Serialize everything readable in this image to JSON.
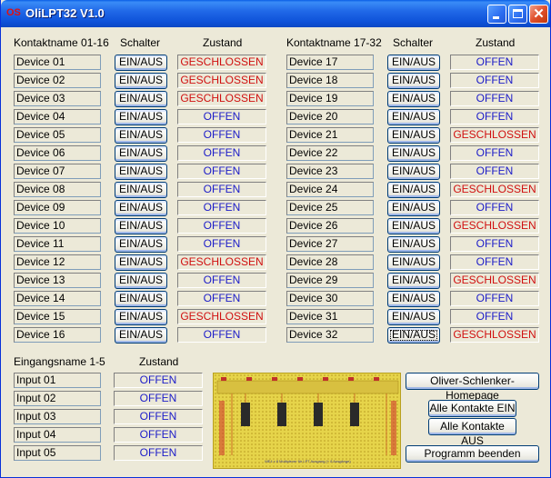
{
  "window": {
    "title": "OliLPT32 V1.0",
    "icon_text": "OS"
  },
  "left_group": {
    "headers": {
      "name": "Kontaktname 01-16",
      "switch": "Schalter",
      "state": "Zustand"
    },
    "rows": [
      {
        "name": "Device 01",
        "switch": "EIN/AUS",
        "state": "GESCHLOSSEN"
      },
      {
        "name": "Device 02",
        "switch": "EIN/AUS",
        "state": "GESCHLOSSEN"
      },
      {
        "name": "Device 03",
        "switch": "EIN/AUS",
        "state": "GESCHLOSSEN"
      },
      {
        "name": "Device 04",
        "switch": "EIN/AUS",
        "state": "OFFEN"
      },
      {
        "name": "Device 05",
        "switch": "EIN/AUS",
        "state": "OFFEN"
      },
      {
        "name": "Device 06",
        "switch": "EIN/AUS",
        "state": "OFFEN"
      },
      {
        "name": "Device 07",
        "switch": "EIN/AUS",
        "state": "OFFEN"
      },
      {
        "name": "Device 08",
        "switch": "EIN/AUS",
        "state": "OFFEN"
      },
      {
        "name": "Device 09",
        "switch": "EIN/AUS",
        "state": "OFFEN"
      },
      {
        "name": "Device 10",
        "switch": "EIN/AUS",
        "state": "OFFEN"
      },
      {
        "name": "Device 11",
        "switch": "EIN/AUS",
        "state": "OFFEN"
      },
      {
        "name": "Device 12",
        "switch": "EIN/AUS",
        "state": "GESCHLOSSEN"
      },
      {
        "name": "Device 13",
        "switch": "EIN/AUS",
        "state": "OFFEN"
      },
      {
        "name": "Device 14",
        "switch": "EIN/AUS",
        "state": "OFFEN"
      },
      {
        "name": "Device 15",
        "switch": "EIN/AUS",
        "state": "GESCHLOSSEN"
      },
      {
        "name": "Device 16",
        "switch": "EIN/AUS",
        "state": "OFFEN"
      }
    ]
  },
  "right_group": {
    "headers": {
      "name": "Kontaktname 17-32",
      "switch": "Schalter",
      "state": "Zustand"
    },
    "rows": [
      {
        "name": "Device 17",
        "switch": "EIN/AUS",
        "state": "OFFEN"
      },
      {
        "name": "Device 18",
        "switch": "EIN/AUS",
        "state": "OFFEN"
      },
      {
        "name": "Device 19",
        "switch": "EIN/AUS",
        "state": "OFFEN"
      },
      {
        "name": "Device 20",
        "switch": "EIN/AUS",
        "state": "OFFEN"
      },
      {
        "name": "Device 21",
        "switch": "EIN/AUS",
        "state": "GESCHLOSSEN"
      },
      {
        "name": "Device 22",
        "switch": "EIN/AUS",
        "state": "OFFEN"
      },
      {
        "name": "Device 23",
        "switch": "EIN/AUS",
        "state": "OFFEN"
      },
      {
        "name": "Device 24",
        "switch": "EIN/AUS",
        "state": "GESCHLOSSEN"
      },
      {
        "name": "Device 25",
        "switch": "EIN/AUS",
        "state": "OFFEN"
      },
      {
        "name": "Device 26",
        "switch": "EIN/AUS",
        "state": "GESCHLOSSEN"
      },
      {
        "name": "Device 27",
        "switch": "EIN/AUS",
        "state": "OFFEN"
      },
      {
        "name": "Device 28",
        "switch": "EIN/AUS",
        "state": "OFFEN"
      },
      {
        "name": "Device 29",
        "switch": "EIN/AUS",
        "state": "GESCHLOSSEN"
      },
      {
        "name": "Device 30",
        "switch": "EIN/AUS",
        "state": "OFFEN"
      },
      {
        "name": "Device 31",
        "switch": "EIN/AUS",
        "state": "OFFEN"
      },
      {
        "name": "Device 32",
        "switch": "EIN/AUS",
        "state": "GESCHLOSSEN"
      }
    ]
  },
  "inputs": {
    "headers": {
      "name": "Eingangsname 1-5",
      "state": "Zustand"
    },
    "rows": [
      {
        "name": "Input 01",
        "state": "OFFEN"
      },
      {
        "name": "Input 02",
        "state": "OFFEN"
      },
      {
        "name": "Input 03",
        "state": "OFFEN"
      },
      {
        "name": "Input 04",
        "state": "OFFEN"
      },
      {
        "name": "Input 05",
        "state": "OFFEN"
      }
    ]
  },
  "board": {
    "caption": "ME4 x 8 Multiplexer für LPT Ausgang (+ 8 Ausgänge)"
  },
  "buttons": {
    "homepage": "Oliver-Schlenker-Homepage",
    "all_on": "Alle Kontakte EIN",
    "all_off": "Alle Kontakte AUS",
    "exit": "Programm beenden"
  },
  "colors": {
    "open": "#1c1cc8",
    "closed": "#d01010",
    "titlebar": "#0e52d9"
  }
}
